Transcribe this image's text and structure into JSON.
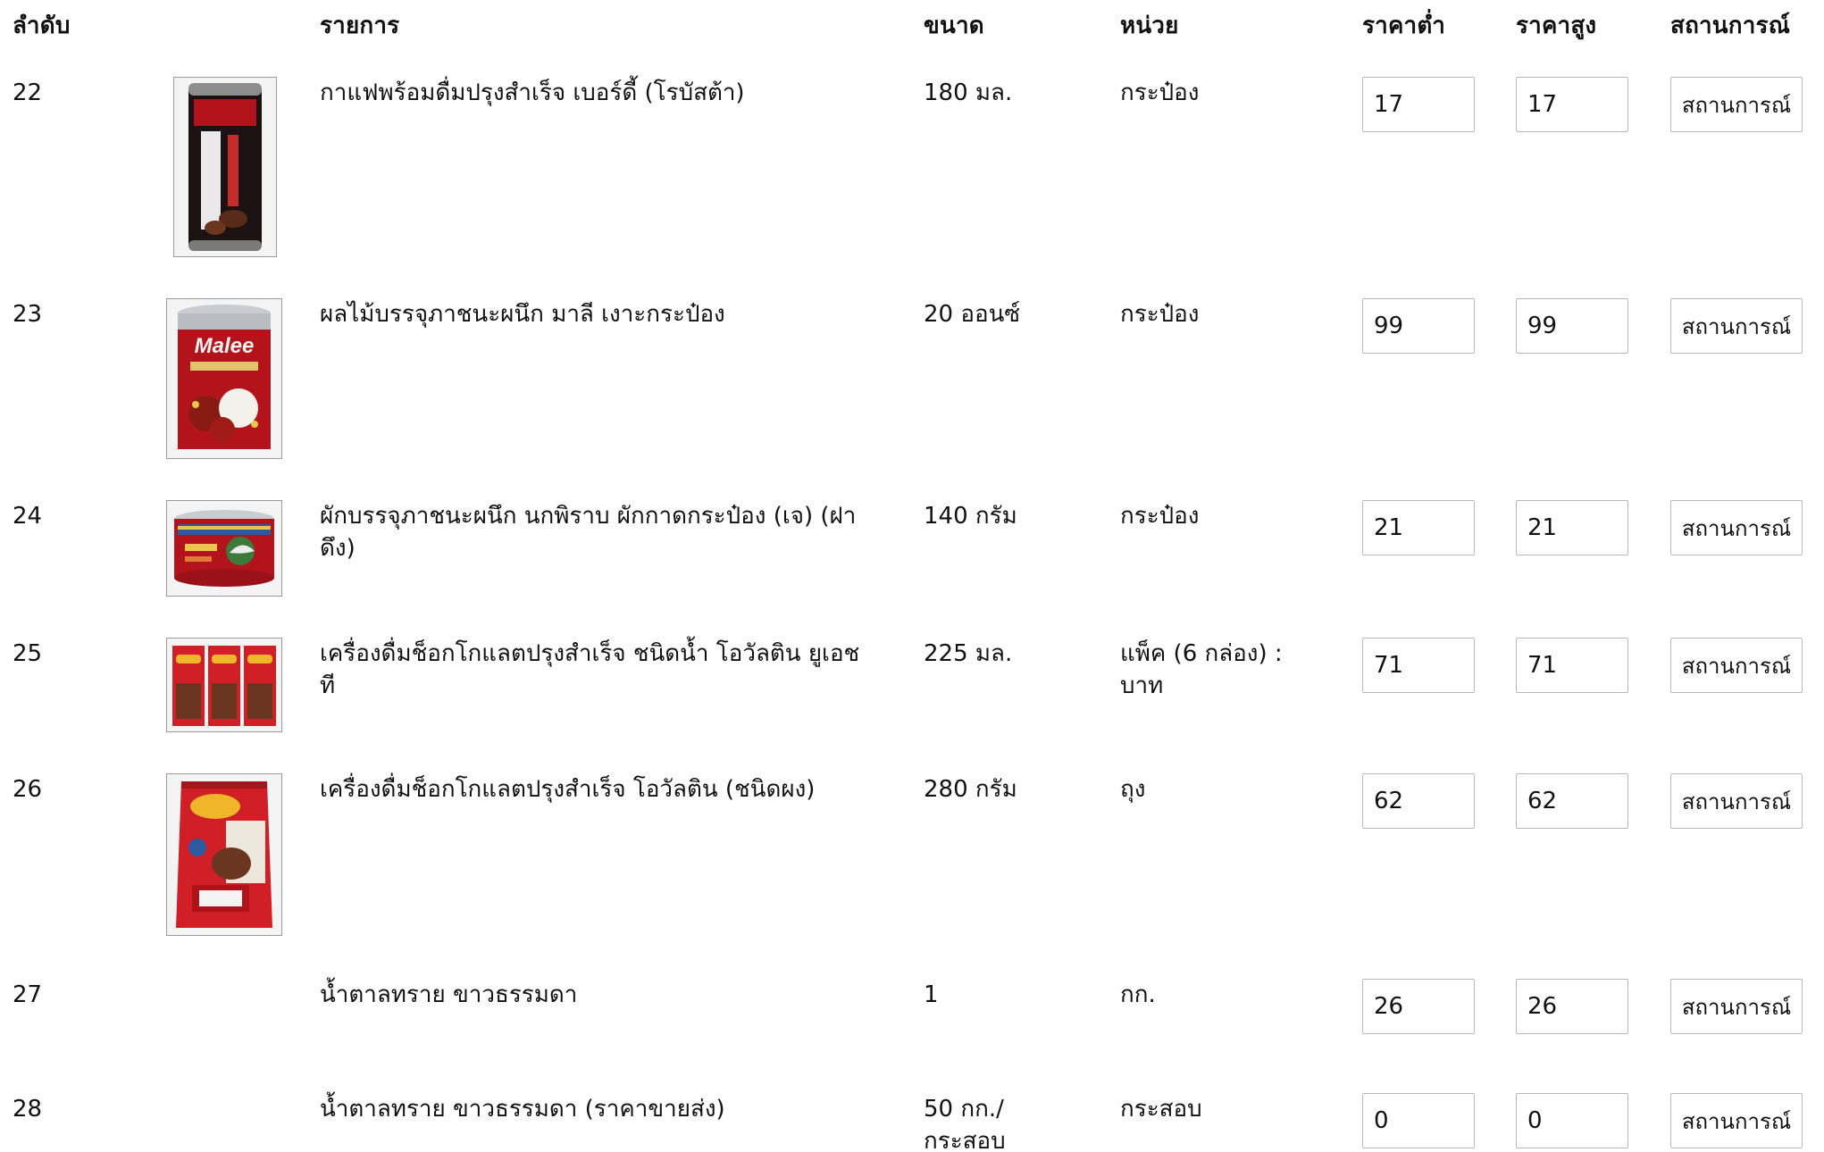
{
  "headers": {
    "index": "ลำดับ",
    "item": "รายการ",
    "size": "ขนาด",
    "unit": "หน่วย",
    "price_low": "ราคาต่ำ",
    "price_high": "ราคาสูง",
    "status": "สถานการณ์"
  },
  "rows": [
    {
      "index": "22",
      "name": "กาแฟพร้อมดื่มปรุงสำเร็จ เบอร์ดี้ (โรบัสต้า)",
      "size": "180 มล.",
      "unit": "กระป๋อง",
      "low": "17",
      "high": "17",
      "status": "สถานการณ์"
    },
    {
      "index": "23",
      "name": "ผลไม้บรรจุภาชนะผนึก มาลี เงาะกระป๋อง",
      "size": "20 ออนซ์",
      "unit": "กระป๋อง",
      "low": "99",
      "high": "99",
      "status": "สถานการณ์",
      "brand": "Malee"
    },
    {
      "index": "24",
      "name": "ผักบรรจุภาชนะผนึก นกพิราบ ผักกาดกระป๋อง (เจ) (ฝาดึง)",
      "size": "140 กรัม",
      "unit": "กระป๋อง",
      "low": "21",
      "high": "21",
      "status": "สถานการณ์"
    },
    {
      "index": "25",
      "name": "เครื่องดื่มช็อกโกแลตปรุงสำเร็จ ชนิดน้ำ โอวัลติน ยูเอชที",
      "size": "225 มล.",
      "unit": "แพ็ค (6 กล่อง) : บาท",
      "low": "71",
      "high": "71",
      "status": "สถานการณ์"
    },
    {
      "index": "26",
      "name": "เครื่องดื่มช็อกโกแลตปรุงสำเร็จ โอวัลติน (ชนิดผง)",
      "size": "280 กรัม",
      "unit": "ถุง",
      "low": "62",
      "high": "62",
      "status": "สถานการณ์"
    },
    {
      "index": "27",
      "name": "น้ำตาลทราย ขาวธรรมดา",
      "size": "1",
      "unit": "กก.",
      "low": "26",
      "high": "26",
      "status": "สถานการณ์"
    },
    {
      "index": "28",
      "name": "น้ำตาลทราย ขาวธรรมดา (ราคาขายส่ง)",
      "size": "50 กก./กระสอบ",
      "unit": "กระสอบ",
      "low": "0",
      "high": "0",
      "status": "สถานการณ์"
    }
  ],
  "colors": {
    "text": "#111111",
    "input_border": "#b9b9b9",
    "can_red": "#b3141c",
    "can_silver": "#c9cdd2"
  },
  "icons": {
    "row22": "coffee-can-image",
    "row23": "rambutan-can-image",
    "row24": "pigeon-can-image",
    "row25": "uht-pack-image",
    "row26": "powder-bag-image"
  }
}
